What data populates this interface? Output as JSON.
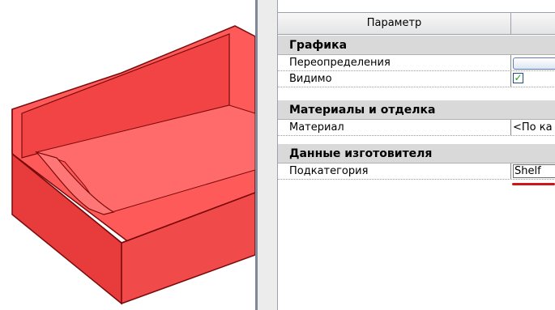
{
  "colors": {
    "model_fill": "#ff5a5a",
    "model_stroke": "#7a0a0a",
    "checkbox_mark": "#1f9e2a",
    "highlight": "#d0141c"
  },
  "properties": {
    "header": {
      "param_label": "Параметр",
      "value_label": ""
    },
    "groups": [
      {
        "title": "Графика",
        "rows": [
          {
            "label": "Переопределения",
            "value_type": "button",
            "value": ""
          },
          {
            "label": "Видимо",
            "value_type": "checkbox",
            "checked": true,
            "check_glyph": "✓"
          }
        ]
      },
      {
        "title": "Материалы и отделка",
        "rows": [
          {
            "label": "Материал",
            "value_type": "text",
            "value": "<По ка"
          }
        ]
      },
      {
        "title": "Данные изготовителя",
        "rows": [
          {
            "label": "Подкатегория",
            "value_type": "input",
            "value": "Shelf"
          }
        ]
      }
    ]
  },
  "icons": {
    "model": "shelf-3d-model",
    "check": "checkmark-icon"
  }
}
